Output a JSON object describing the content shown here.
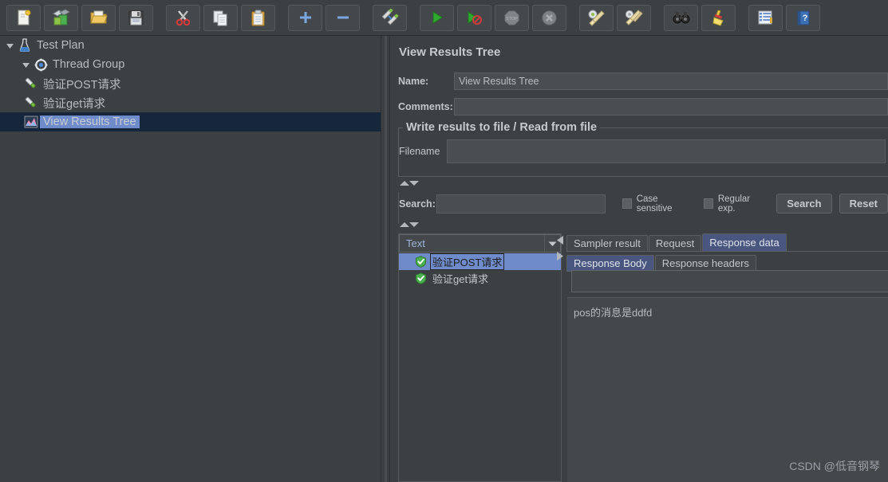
{
  "toolbar": {
    "buttons": [
      {
        "name": "new-button",
        "icon": "new-document-icon",
        "tooltip": "New"
      },
      {
        "name": "templates-button",
        "icon": "templates-icon",
        "tooltip": "Templates"
      },
      {
        "name": "open-button",
        "icon": "open-folder-icon",
        "tooltip": "Open"
      },
      {
        "name": "save-button",
        "icon": "save-floppy-icon",
        "tooltip": "Save Test Plan"
      },
      {
        "name": "cut-button",
        "icon": "scissors-icon",
        "tooltip": "Cut"
      },
      {
        "name": "copy-button",
        "icon": "copy-icon",
        "tooltip": "Copy"
      },
      {
        "name": "paste-button",
        "icon": "clipboard-paste-icon",
        "tooltip": "Paste"
      },
      {
        "name": "expand-all-button",
        "icon": "plus-icon",
        "tooltip": "Expand All"
      },
      {
        "name": "collapse-all-button",
        "icon": "minus-icon",
        "tooltip": "Collapse All"
      },
      {
        "name": "toggle-button",
        "icon": "toggle-pencils-icon",
        "tooltip": "Toggle"
      },
      {
        "name": "start-button",
        "icon": "green-play-icon",
        "tooltip": "Start"
      },
      {
        "name": "start-no-timers-button",
        "icon": "play-no-timers-icon",
        "tooltip": "Start no pauses"
      },
      {
        "name": "stop-button",
        "icon": "stop-sign-icon",
        "tooltip": "Stop"
      },
      {
        "name": "shutdown-button",
        "icon": "shutdown-icon",
        "tooltip": "Shutdown"
      },
      {
        "name": "clear-button",
        "icon": "gear-broom-icon",
        "tooltip": "Clear"
      },
      {
        "name": "clear-all-button",
        "icon": "gear-broom-all-icon",
        "tooltip": "Clear All"
      },
      {
        "name": "search-button",
        "icon": "binoculars-icon",
        "tooltip": "Search"
      },
      {
        "name": "reset-search-button",
        "icon": "broom-icon",
        "tooltip": "Reset Search"
      },
      {
        "name": "function-helper-button",
        "icon": "list-icon",
        "tooltip": "Function Helper Dialog"
      },
      {
        "name": "help-button",
        "icon": "help-book-icon",
        "tooltip": "Help"
      }
    ]
  },
  "tree": {
    "nodes": [
      {
        "label": "Test Plan",
        "icon": "test-plan-icon",
        "indent": 0,
        "twisty": "expanded",
        "selected": false
      },
      {
        "label": "Thread Group",
        "icon": "thread-group-icon",
        "indent": 1,
        "twisty": "expanded",
        "selected": false
      },
      {
        "label": "验证POST请求",
        "icon": "http-sampler-icon",
        "indent": 2,
        "twisty": "none",
        "selected": false
      },
      {
        "label": "验证get请求",
        "icon": "http-sampler-icon",
        "indent": 2,
        "twisty": "none",
        "selected": false
      },
      {
        "label": "View Results Tree",
        "icon": "view-results-tree-icon",
        "indent": 2,
        "twisty": "none",
        "selected": true
      }
    ]
  },
  "panel": {
    "title": "View Results Tree",
    "name_label": "Name:",
    "name_value": "View Results Tree",
    "comments_label": "Comments:",
    "comments_value": "",
    "groupbox_title": "Write results to file / Read from file",
    "filename_label": "Filename",
    "filename_value": "",
    "search_label": "Search:",
    "search_value": "",
    "case_sensitive_label": "Case sensitive",
    "regular_exp_label": "Regular exp.",
    "search_button_label": "Search",
    "reset_button_label": "Reset"
  },
  "results": {
    "render_selector_value": "Text",
    "items": [
      {
        "label": "验证POST请求",
        "status": "success",
        "selected": true
      },
      {
        "label": "验证get请求",
        "status": "success",
        "selected": false
      }
    ]
  },
  "tabs": {
    "primary": [
      {
        "label": "Sampler result",
        "active": false
      },
      {
        "label": "Request",
        "active": false
      },
      {
        "label": "Response data",
        "active": true
      }
    ],
    "secondary": [
      {
        "label": "Response Body",
        "active": true
      },
      {
        "label": "Response headers",
        "active": false
      }
    ],
    "find_value": "",
    "response_body": "pos的消息是ddfd"
  },
  "watermark": "CSDN @低音钢琴",
  "colors": {
    "background": "#3c4043",
    "panel": "#44484b",
    "selection": "#6f8bc9",
    "tab_active": "#495780",
    "text": "#c2c6ca"
  }
}
